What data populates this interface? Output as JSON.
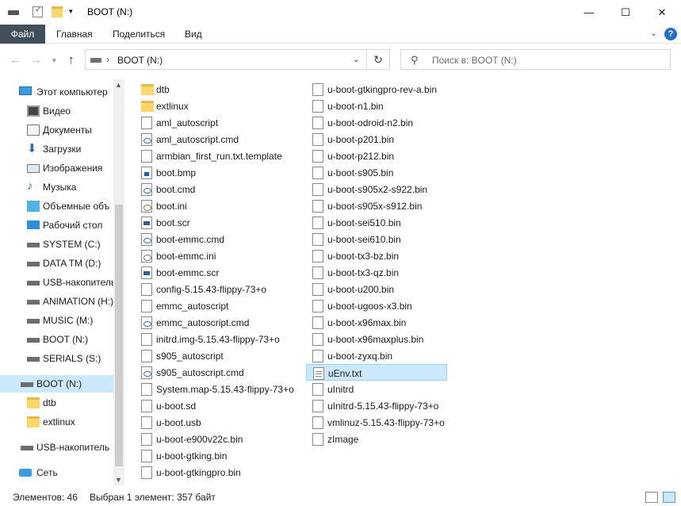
{
  "window": {
    "title": "BOOT (N:)",
    "minimize": "—",
    "maximize": "☐",
    "close": "✕"
  },
  "ribbon": {
    "tabs": [
      "Файл",
      "Главная",
      "Поделиться",
      "Вид"
    ],
    "expand_icon": "chevron-down",
    "help": "?"
  },
  "address": {
    "path": "BOOT (N:)",
    "search_placeholder": "Поиск в: BOOT (N:)"
  },
  "nav": {
    "items": [
      {
        "label": "Этот компьютер",
        "icon": "computer-icon"
      },
      {
        "label": "Видео",
        "icon": "video-icon"
      },
      {
        "label": "Документы",
        "icon": "documents-icon"
      },
      {
        "label": "Загрузки",
        "icon": "download-icon"
      },
      {
        "label": "Изображения",
        "icon": "pictures-icon"
      },
      {
        "label": "Музыка",
        "icon": "music-icon"
      },
      {
        "label": "Объемные объ",
        "icon": "3d-objects-icon"
      },
      {
        "label": "Рабочий стол",
        "icon": "desktop-icon"
      },
      {
        "label": "SYSTEM (C:)",
        "icon": "drive-icon"
      },
      {
        "label": "DATA TM (D:)",
        "icon": "drive-icon"
      },
      {
        "label": "USB-накопитель",
        "icon": "drive-icon"
      },
      {
        "label": "ANIMATION (H:)",
        "icon": "drive-icon"
      },
      {
        "label": "MUSIC (M:)",
        "icon": "drive-icon"
      },
      {
        "label": "BOOT (N:)",
        "icon": "drive-icon"
      },
      {
        "label": "SERIALS (S:)",
        "icon": "drive-icon"
      },
      {
        "label": "BOOT (N:)",
        "icon": "drive-icon"
      },
      {
        "label": "dtb",
        "icon": "folder-icon"
      },
      {
        "label": "extlinux",
        "icon": "folder-icon"
      },
      {
        "label": "USB-накопитель",
        "icon": "drive-icon"
      },
      {
        "label": "Сеть",
        "icon": "network-icon"
      }
    ]
  },
  "files": {
    "column1": [
      {
        "name": "dtb",
        "type": "folder"
      },
      {
        "name": "extlinux",
        "type": "folder"
      },
      {
        "name": "aml_autoscript",
        "type": "doc"
      },
      {
        "name": "aml_autoscript.cmd",
        "type": "cmd"
      },
      {
        "name": "armbian_first_run.txt.template",
        "type": "doc"
      },
      {
        "name": "boot.bmp",
        "type": "bmp"
      },
      {
        "name": "boot.cmd",
        "type": "cmd"
      },
      {
        "name": "boot.ini",
        "type": "ini"
      },
      {
        "name": "boot.scr",
        "type": "scr"
      },
      {
        "name": "boot-emmc.cmd",
        "type": "cmd"
      },
      {
        "name": "boot-emmc.ini",
        "type": "ini"
      },
      {
        "name": "boot-emmc.scr",
        "type": "scr"
      },
      {
        "name": "config-5.15.43-flippy-73+o",
        "type": "doc"
      },
      {
        "name": "emmc_autoscript",
        "type": "doc"
      },
      {
        "name": "emmc_autoscript.cmd",
        "type": "cmd"
      },
      {
        "name": "initrd.img-5.15.43-flippy-73+o",
        "type": "doc"
      },
      {
        "name": "s905_autoscript",
        "type": "doc"
      },
      {
        "name": "s905_autoscript.cmd",
        "type": "cmd"
      },
      {
        "name": "System.map-5.15.43-flippy-73+o",
        "type": "doc"
      },
      {
        "name": "u-boot.sd",
        "type": "doc"
      },
      {
        "name": "u-boot.usb",
        "type": "doc"
      },
      {
        "name": "u-boot-e900v22c.bin",
        "type": "doc"
      },
      {
        "name": "u-boot-gtking.bin",
        "type": "doc"
      },
      {
        "name": "u-boot-gtkingpro.bin",
        "type": "doc"
      }
    ],
    "column2": [
      {
        "name": "u-boot-gtkingpro-rev-a.bin",
        "type": "doc"
      },
      {
        "name": "u-boot-n1.bin",
        "type": "doc"
      },
      {
        "name": "u-boot-odroid-n2.bin",
        "type": "doc"
      },
      {
        "name": "u-boot-p201.bin",
        "type": "doc"
      },
      {
        "name": "u-boot-p212.bin",
        "type": "doc"
      },
      {
        "name": "u-boot-s905.bin",
        "type": "doc"
      },
      {
        "name": "u-boot-s905x2-s922.bin",
        "type": "doc"
      },
      {
        "name": "u-boot-s905x-s912.bin",
        "type": "doc"
      },
      {
        "name": "u-boot-sei510.bin",
        "type": "doc"
      },
      {
        "name": "u-boot-sei610.bin",
        "type": "doc"
      },
      {
        "name": "u-boot-tx3-bz.bin",
        "type": "doc"
      },
      {
        "name": "u-boot-tx3-qz.bin",
        "type": "doc"
      },
      {
        "name": "u-boot-u200.bin",
        "type": "doc"
      },
      {
        "name": "u-boot-ugoos-x3.bin",
        "type": "doc"
      },
      {
        "name": "u-boot-x96max.bin",
        "type": "doc"
      },
      {
        "name": "u-boot-x96maxplus.bin",
        "type": "doc"
      },
      {
        "name": "u-boot-zyxq.bin",
        "type": "doc"
      },
      {
        "name": "uEnv.txt",
        "type": "txt",
        "selected": true
      },
      {
        "name": "uInitrd",
        "type": "doc"
      },
      {
        "name": "uInitrd-5.15.43-flippy-73+o",
        "type": "doc"
      },
      {
        "name": "vmlinuz-5.15.43-flippy-73+o",
        "type": "doc"
      },
      {
        "name": "zImage",
        "type": "doc"
      }
    ]
  },
  "status": {
    "count": "Элементов: 46",
    "selection": "Выбран 1 элемент: 357 байт"
  },
  "colors": {
    "file_tab": "#414e5b",
    "selection": "#cce8ff",
    "folder": "#ffd768"
  }
}
